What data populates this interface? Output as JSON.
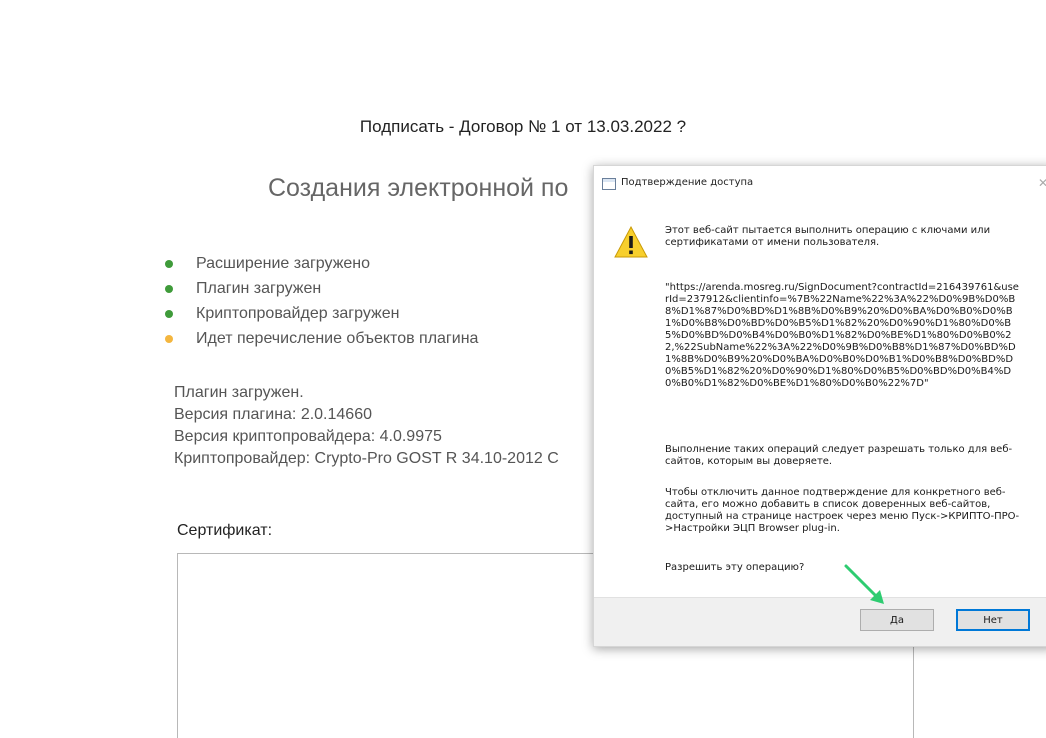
{
  "page": {
    "title": "Подписать - Договор № 1 от 13.03.2022 ?",
    "section_heading": "Создания электронной по",
    "status_items": [
      {
        "label": "Расширение загружено",
        "state": "done"
      },
      {
        "label": "Плагин загружен",
        "state": "done"
      },
      {
        "label": "Криптопровайдер загружен",
        "state": "done"
      },
      {
        "label": "Идет перечисление объектов плагина",
        "state": "pending"
      }
    ],
    "info_lines": [
      "Плагин загружен.",
      "Версия плагина: 2.0.14660",
      "Версия криптопровайдера: 4.0.9975",
      "Криптопровайдер: Crypto-Pro GOST R 34.10-2012 C"
    ],
    "certificate_label": "Сертификат:"
  },
  "dialog": {
    "title": "Подтверждение доступа",
    "intro": "Этот веб-сайт пытается выполнить операцию с ключами или сертификатами от имени пользователя.",
    "url": "\"https://arenda.mosreg.ru/SignDocument?contractId=216439761&userId=237912&clientinfo=%7B%22Name%22%3A%22%D0%9B%D0%B8%D1%87%D0%BD%D1%8B%D0%B9%20%D0%BA%D0%B0%D0%B1%D0%B8%D0%BD%D0%B5%D1%82%20%D0%90%D1%80%D0%B5%D0%BD%D0%B4%D0%B0%D1%82%D0%BE%D1%80%D0%B0%22,%22SubName%22%3A%22%D0%9B%D0%B8%D1%87%D0%BD%D1%8B%D0%B9%20%D0%BA%D0%B0%D0%B1%D0%B8%D0%BD%D0%B5%D1%82%20%D0%90%D1%80%D0%B5%D0%BD%D0%B4%D0%B0%D1%82%D0%BE%D1%80%D0%B0%22%7D\"",
    "warning": "Выполнение таких операций следует разрешать только для веб-сайтов, которым вы доверяете.",
    "disable_hint": "Чтобы отключить данное подтверждение для конкретного веб-сайта, его можно добавить в список доверенных веб-сайтов, доступный на странице настроек через меню Пуск->КРИПТО-ПРО->Настройки ЭЦП Browser plug-in.",
    "question": "Разрешить эту операцию?",
    "yes_label": "Да",
    "no_label": "Нет"
  },
  "colors": {
    "status_done": "#3f9b3a",
    "status_pending": "#f4b63f",
    "annotation_arrow": "#2ecc71",
    "focus_border": "#0078d7"
  },
  "icons": {
    "warning": "warning-triangle-icon",
    "close": "close-icon",
    "app": "app-window-icon"
  }
}
